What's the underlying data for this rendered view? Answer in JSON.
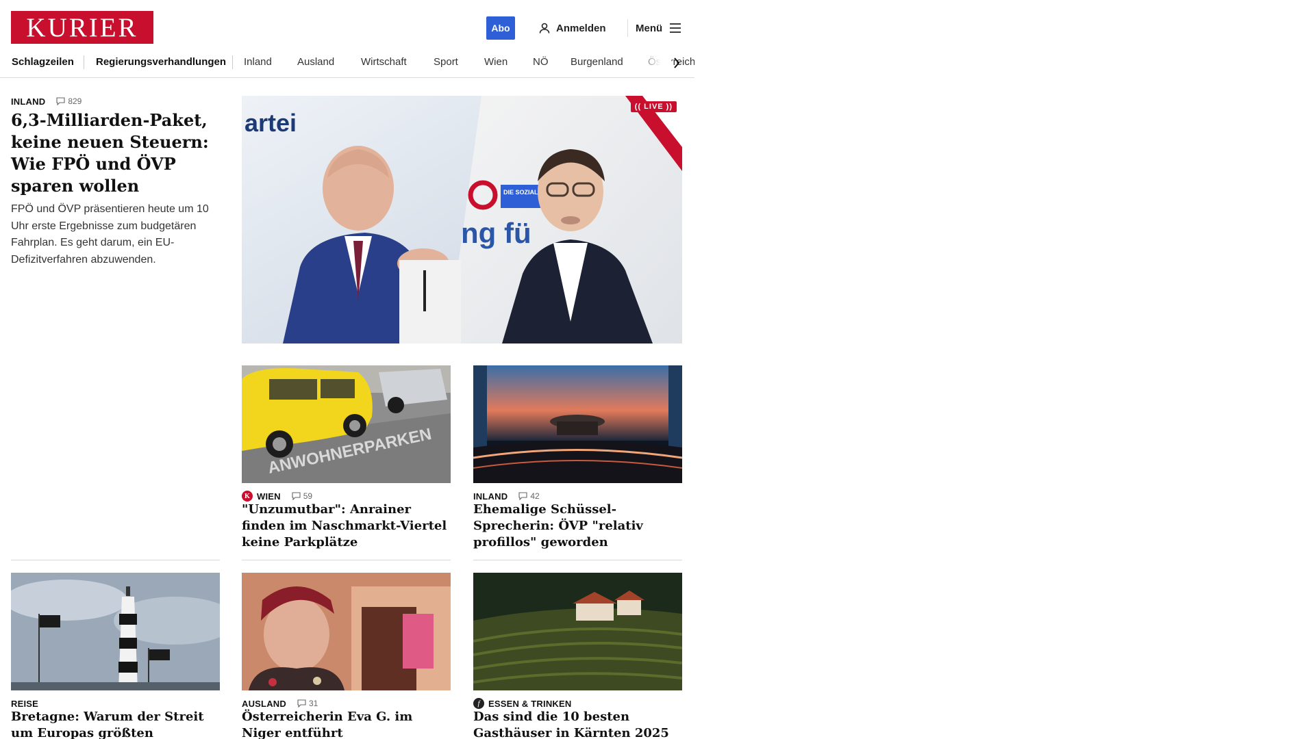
{
  "header": {
    "logo_text": "KURIER",
    "abo_label": "Abo",
    "login_label": "Anmelden",
    "menu_label": "Menü",
    "brand_color": "#c8102e",
    "abo_color": "#2f5fd6"
  },
  "nav": {
    "items": [
      {
        "label": "Schlagzeilen",
        "bold": true
      },
      {
        "label": "Regierungsverhandlungen",
        "bold": true
      },
      {
        "label": "Inland"
      },
      {
        "label": "Ausland"
      },
      {
        "label": "Wirtschaft"
      },
      {
        "label": "Sport"
      },
      {
        "label": "Wien"
      },
      {
        "label": "NÖ"
      },
      {
        "label": "Burgenland"
      },
      {
        "label": "Österreich"
      }
    ],
    "scroll_icon": "chevron-right-icon"
  },
  "lead": {
    "category": "INLAND",
    "comments": "829",
    "title": "6,3-Milliarden-Paket, keine neuen Steuern: Wie FPÖ und ÖVP sparen wollen",
    "text": "FPÖ und ÖVP präsentieren heute um 10 Uhr erste Ergebnisse zum budgetären Fahrplan. Es geht darum, ein EU-Defizitverfahren abzuwenden.",
    "live_label": "(( LIVE ))",
    "image_text_1": "artei",
    "image_text_2": "ng fü",
    "image_text_3": "DIE SOZIALE HEIMATPARTEI"
  },
  "cards": [
    {
      "category": "WIEN",
      "comments": "59",
      "badge": "K",
      "title": "\"Unzumutbar\": Anrainer finden im Naschmarkt-Viertel keine Parkplätze",
      "image_text": "ANWOHNERPARKEN"
    },
    {
      "category": "INLAND",
      "comments": "42",
      "title": "Ehemalige Schüssel-Sprecherin: ÖVP \"relativ profillos\" geworden"
    },
    {
      "category": "REISE",
      "title": "Bretagne: Warum der Streit um Europas größten Leuchtturm eskaliert"
    },
    {
      "category": "AUSLAND",
      "comments": "31",
      "title": "Österreicherin Eva G. im Niger entführt"
    },
    {
      "category": "ESSEN & TRINKEN",
      "badge": "f",
      "title": "Das sind die 10 besten Gasthäuser in Kärnten 2025"
    }
  ]
}
